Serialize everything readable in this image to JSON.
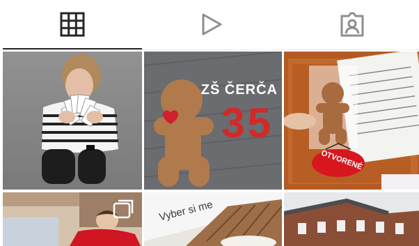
{
  "tabs": [
    {
      "id": "posts",
      "icon": "grid-icon",
      "selected": true
    },
    {
      "id": "reels",
      "icon": "play-icon",
      "selected": false
    },
    {
      "id": "tagged",
      "icon": "tagged-person-icon",
      "selected": false
    }
  ],
  "posts": [
    {
      "description": "woman holding cards",
      "overlay": ""
    },
    {
      "description": "gingerbread cookie",
      "overlay_school": "ZŠ ČERČA",
      "overlay_number": "35"
    },
    {
      "description": "gingerbread on door with sign",
      "overlay_sign": "OTVORENÉ"
    },
    {
      "description": "boy in red sweater",
      "overlay": ""
    },
    {
      "description": "cookies on tray",
      "overlay_text": "Vyber si me"
    },
    {
      "description": "brick building",
      "overlay": ""
    }
  ],
  "colors": {
    "accent": "#262626",
    "icon_inactive": "#8e8e8e",
    "divider": "#efefef",
    "number_red": "#d32828"
  }
}
